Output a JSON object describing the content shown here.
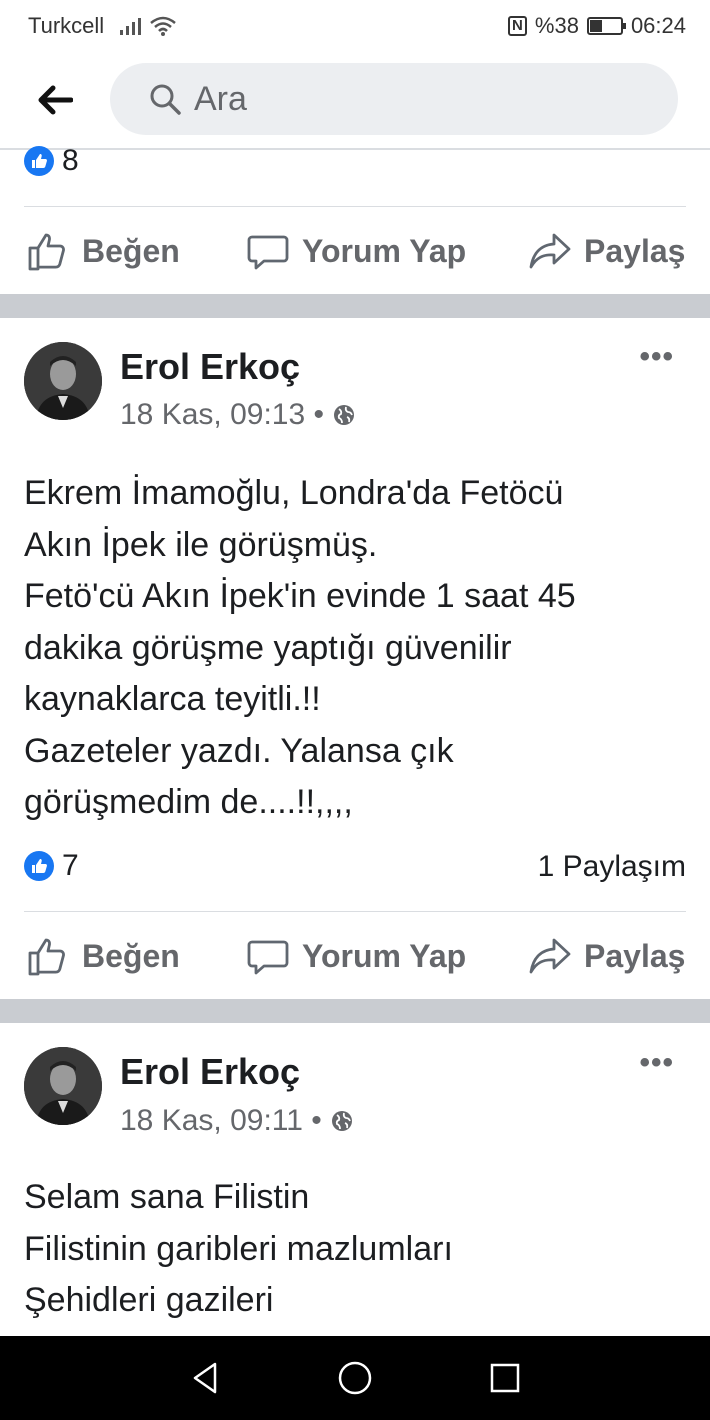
{
  "status_bar": {
    "carrier": "Turkcell",
    "battery_text": "%38",
    "battery_level": 0.38,
    "time": "06:24",
    "icons": [
      "signal-icon",
      "wifi-icon",
      "nfc-icon",
      "battery-icon"
    ]
  },
  "header": {
    "back_icon": "back-arrow-icon",
    "search_placeholder": "Ara"
  },
  "top_post": {
    "reaction_count": "8"
  },
  "action_labels": {
    "like": "Beğen",
    "comment": "Yorum Yap",
    "share": "Paylaş"
  },
  "posts": [
    {
      "author": "Erol Erkoç",
      "timestamp": "18 Kas, 09:13 •",
      "lines": [
        "Ekrem İmamoğlu, Londra'da Fetöcü",
        "Akın İpek ile görüşmüş.",
        "Fetö'cü Akın İpek'in evinde 1 saat 45",
        "dakika görüşme yaptığı güvenilir",
        "kaynaklarca teyitli.!!",
        "Gazeteler yazdı. Yalansa çık",
        "görüşmedim de....!!,,,,"
      ],
      "reaction_count": "7",
      "shares": "1 Paylaşım"
    },
    {
      "author": "Erol Erkoç",
      "timestamp": "18 Kas, 09:11 •",
      "lines": [
        "Selam sana Filistin",
        "Filistinin garibleri mazlumları",
        "Şehidleri gazileri"
      ]
    }
  ],
  "colors": {
    "accent": "#1877f2",
    "separator": "#c9ccd1",
    "muted_text": "#65676b"
  }
}
